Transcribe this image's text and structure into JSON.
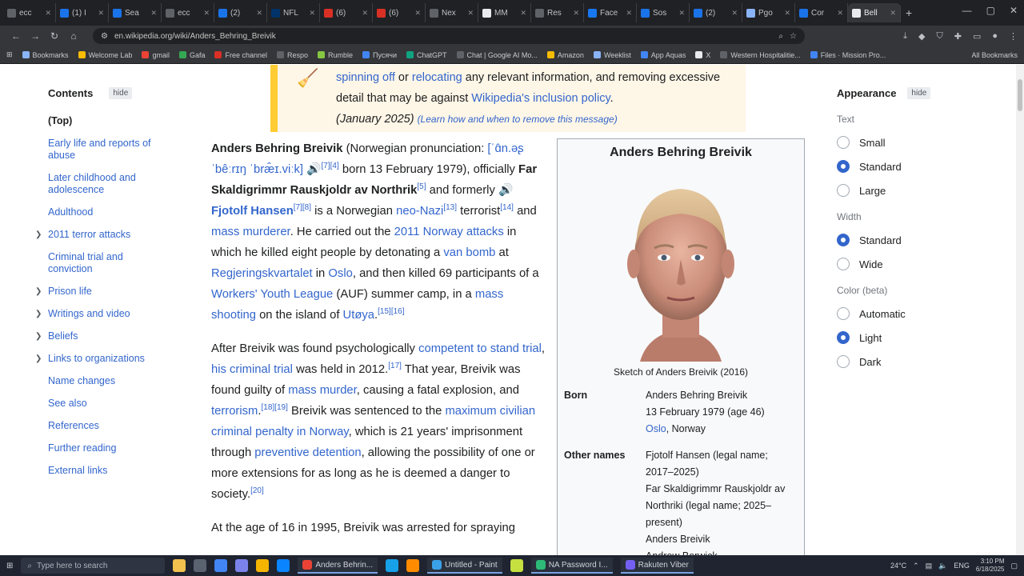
{
  "browser": {
    "tabs": [
      {
        "label": "ecc",
        "color": "#5f6368"
      },
      {
        "label": "(1) I",
        "color": "#1a73e8"
      },
      {
        "label": "Sea",
        "color": "#1a73e8"
      },
      {
        "label": "ecc",
        "color": "#5f6368"
      },
      {
        "label": "(2)",
        "color": "#1a73e8"
      },
      {
        "label": "NFL",
        "color": "#013369"
      },
      {
        "label": "(6)",
        "color": "#d93025"
      },
      {
        "label": "(6)",
        "color": "#d93025"
      },
      {
        "label": "Nex",
        "color": "#5f6368"
      },
      {
        "label": "MM",
        "color": "#e8eaed"
      },
      {
        "label": "Res",
        "color": "#5f6368"
      },
      {
        "label": "Face",
        "color": "#1877f2"
      },
      {
        "label": "Sos",
        "color": "#1a73e8"
      },
      {
        "label": "(2)",
        "color": "#1a73e8"
      },
      {
        "label": "Pgo",
        "color": "#8ab4f8"
      },
      {
        "label": "Cor",
        "color": "#1a73e8"
      },
      {
        "label": "Bell",
        "color": "#e8eaed"
      }
    ],
    "url": "en.wikipedia.org/wiki/Anders_Behring_Breivik",
    "bookmarks": [
      {
        "label": "Bookmarks",
        "color": "#8ab4f8"
      },
      {
        "label": "Welcome Lab",
        "color": "#fbbc04"
      },
      {
        "label": "gmail",
        "color": "#ea4335"
      },
      {
        "label": "Gafa",
        "color": "#34a853"
      },
      {
        "label": "Free channel",
        "color": "#d93025"
      },
      {
        "label": "Respo",
        "color": "#5f6368"
      },
      {
        "label": "Rumble",
        "color": "#85c742"
      },
      {
        "label": "Пусячи",
        "color": "#4285f4"
      },
      {
        "label": "ChatGPT",
        "color": "#10a37f"
      },
      {
        "label": "Chat | Google AI Mo...",
        "color": "#5f6368"
      },
      {
        "label": "Amazon",
        "color": "#fbbc04"
      },
      {
        "label": "Weeklist",
        "color": "#8ab4f8"
      },
      {
        "label": "App Aquas",
        "color": "#4285f4"
      },
      {
        "label": "X",
        "color": "#e8eaed"
      },
      {
        "label": "Western Hospitalitie...",
        "color": "#5f6368"
      },
      {
        "label": "Files · Mission Pro...",
        "color": "#4285f4"
      }
    ],
    "all_bookmarks": "All Bookmarks"
  },
  "toc": {
    "title": "Contents",
    "hide": "hide",
    "items": [
      {
        "label": "(Top)",
        "top": true,
        "chevron": false
      },
      {
        "label": "Early life and reports of abuse",
        "chevron": false
      },
      {
        "label": "Later childhood and adolescence",
        "chevron": false
      },
      {
        "label": "Adulthood",
        "chevron": false
      },
      {
        "label": "2011 terror attacks",
        "chevron": true
      },
      {
        "label": "Criminal trial and conviction",
        "chevron": false
      },
      {
        "label": "Prison life",
        "chevron": true
      },
      {
        "label": "Writings and video",
        "chevron": true
      },
      {
        "label": "Beliefs",
        "chevron": true
      },
      {
        "label": "Links to organizations",
        "chevron": true
      },
      {
        "label": "Name changes",
        "chevron": false
      },
      {
        "label": "See also",
        "chevron": false
      },
      {
        "label": "References",
        "chevron": false
      },
      {
        "label": "Further reading",
        "chevron": false
      },
      {
        "label": "External links",
        "chevron": false
      }
    ]
  },
  "notice": {
    "link1": "spinning off",
    "or": " or ",
    "link2": "relocating",
    "text1": " any relevant information, and removing excessive detail that may be against ",
    "link3": "Wikipedia's inclusion policy",
    "period": ".",
    "date": "(January 2025)",
    "learn": "(Learn how and when to remove this message)"
  },
  "article": {
    "p1": {
      "name": "Anders Behring Breivik",
      "pron_label": " (Norwegian pronunciation: ",
      "ipa": "[ˈɑ̂n.əʂ ˈbêːrɪŋ ˈbræ̂ɪ.viːk]",
      "ref1": "[7][4]",
      "born": " born 13 February 1979), officially ",
      "official": "Far Skaldigrimmr Rauskjoldr av Northrik",
      "ref2": "[5]",
      "formerly": " and formerly ",
      "former": "Fjotolf Hansen",
      "ref3": "[7][8]",
      "is_a": " is a Norwegian ",
      "neonazi": "neo-Nazi",
      "ref4": "[13]",
      "terrorist": " terrorist",
      "ref5": "[14]",
      "and": " and ",
      "massmurderer": "mass murderer",
      "carried": ". He carried out the ",
      "attacks": "2011 Norway attacks",
      "killed": " in which he killed eight people by detonating a ",
      "vanbomb": "van bomb",
      "at": " at ",
      "regj": "Regjeringskvartalet",
      "in": " in ",
      "oslo": "Oslo",
      "then": ", and then killed 69 participants of a ",
      "league": "Workers' Youth League",
      "auf": " (AUF) summer camp, in a ",
      "shooting": "mass shooting",
      "island": " on the island of ",
      "utoya": "Utøya",
      "ref6": "[15][16]"
    },
    "p2": {
      "after": "After Breivik was found psychologically ",
      "competent": "competent to stand trial",
      "comma": ", ",
      "trial": "his criminal trial",
      "held": " was held in 2012.",
      "ref1": "[17]",
      "year": " That year, Breivik was found guilty of ",
      "murder": "mass murder",
      "causing": ", causing a fatal explosion, and ",
      "terrorism": "terrorism",
      "ref2": "[18][19]",
      "sentenced": " Breivik was sentenced to the ",
      "penalty": "maximum civilian criminal penalty in Norway",
      "which": ", which is 21 years' imprisonment through ",
      "detention": "preventive detention",
      "allowing": ", allowing the possibility of one or more extensions for as long as he is deemed a danger to society.",
      "ref3": "[20]"
    },
    "p3": "At the age of 16 in 1995, Breivik was arrested for spraying"
  },
  "infobox": {
    "title": "Anders Behring Breivik",
    "caption": "Sketch of Anders Breivik (2016)",
    "born_label": "Born",
    "born_name": "Anders Behring Breivik",
    "born_date": "13 February 1979 (age 46)",
    "born_place_link": "Oslo",
    "born_place_rest": ", Norway",
    "other_label": "Other names",
    "other_names": [
      "Fjotolf Hansen (legal name; 2017–2025)",
      "Far Skaldigrimmr Rauskjoldr av Northriki (legal name; 2025–present)",
      "Anders Breivik",
      "Andrew Berwick"
    ]
  },
  "appearance": {
    "title": "Appearance",
    "hide": "hide",
    "text_label": "Text",
    "text_options": [
      {
        "label": "Small",
        "selected": false
      },
      {
        "label": "Standard",
        "selected": true
      },
      {
        "label": "Large",
        "selected": false
      }
    ],
    "width_label": "Width",
    "width_options": [
      {
        "label": "Standard",
        "selected": true
      },
      {
        "label": "Wide",
        "selected": false
      }
    ],
    "color_label": "Color (beta)",
    "color_options": [
      {
        "label": "Automatic",
        "selected": false
      },
      {
        "label": "Light",
        "selected": true
      },
      {
        "label": "Dark",
        "selected": false
      }
    ]
  },
  "taskbar": {
    "search_placeholder": "Type here to search",
    "tasks": [
      "Anders Behrin...",
      "Untitled - Paint",
      "NA Password I...",
      "Rakuten Viber"
    ],
    "temp": "24°C",
    "lang": "ENG",
    "time": "3:10 PM",
    "date": "6/18/2025"
  }
}
